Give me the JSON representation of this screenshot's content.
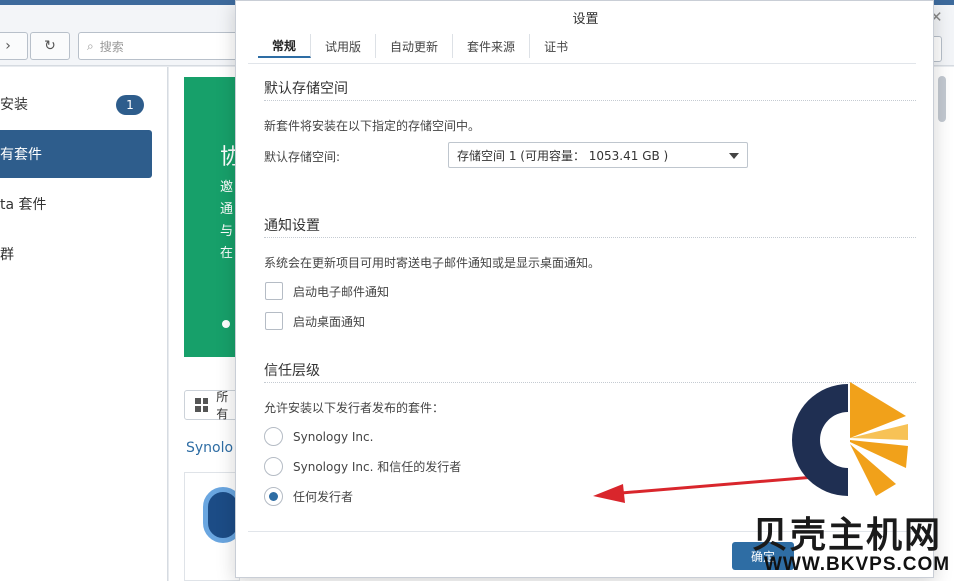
{
  "background_app": {
    "search_placeholder": "搜索",
    "sidebar_items": [
      "安装",
      "有套件",
      "ta 套件",
      "群"
    ],
    "update_badge": "1",
    "banner_heading": "协",
    "banner_text": [
      "邀",
      "通",
      "与",
      "在"
    ],
    "grid_label": "所有",
    "section_link": "Synolo"
  },
  "dialog": {
    "title": "设置",
    "tabs": [
      {
        "label": "常规",
        "active": true
      },
      {
        "label": "试用版",
        "active": false
      },
      {
        "label": "自动更新",
        "active": false
      },
      {
        "label": "套件来源",
        "active": false
      },
      {
        "label": "证书",
        "active": false
      }
    ],
    "storage": {
      "title": "默认存储空间",
      "description": "新套件将安装在以下指定的存储空间中。",
      "field_label": "默认存储空间:",
      "selected_value": "存储空间 1 (可用容量： 1053.41 GB )"
    },
    "notify": {
      "title": "通知设置",
      "description": "系统会在更新项目可用时寄送电子邮件通知或是显示桌面通知。",
      "options": [
        {
          "label": "启动电子邮件通知",
          "checked": false
        },
        {
          "label": "启动桌面通知",
          "checked": false
        }
      ]
    },
    "trust": {
      "title": "信任层级",
      "description": "允许安装以下发行者发布的套件：",
      "options": [
        {
          "label": "Synology Inc.",
          "selected": false
        },
        {
          "label": "Synology Inc. 和信任的发行者",
          "selected": false
        },
        {
          "label": "任何发行者",
          "selected": true
        }
      ]
    },
    "apply_label": "确定"
  },
  "watermark": {
    "name": "贝壳主机网",
    "url": "WWW.BKVPS.COM"
  },
  "colors": {
    "accent": "#2e6da4",
    "sidebar_active": "#2e5d8c",
    "banner": "#17a06a",
    "arrow": "#d9262c",
    "logo_navy": "#1f2f52",
    "logo_orange": "#f1a11a"
  },
  "icons": [
    "back-icon",
    "refresh-icon",
    "search-icon",
    "close-icon",
    "grid-icon",
    "caret-down-icon",
    "bkvps-logo-icon"
  ]
}
